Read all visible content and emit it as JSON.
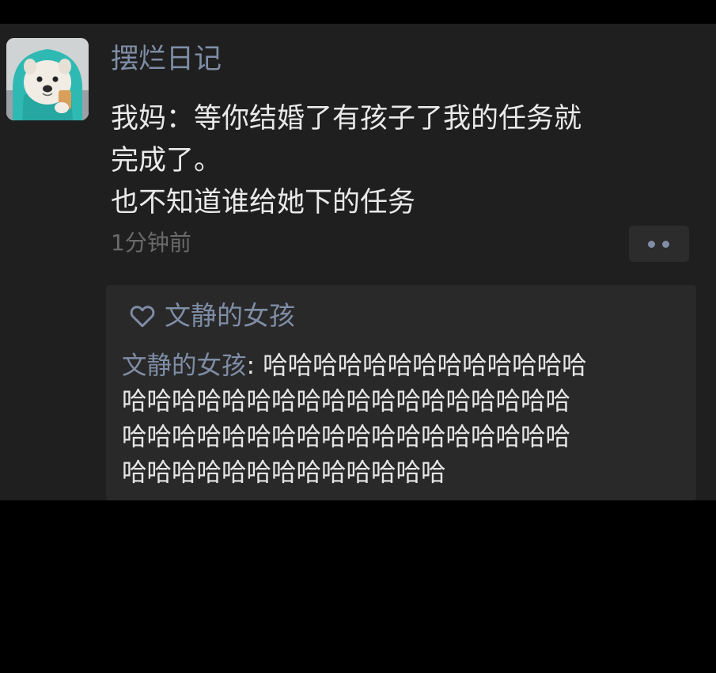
{
  "post": {
    "author": "摆烂日记",
    "lines": [
      "我妈：等你结婚了有孩子了我的任务就",
      "完成了。",
      "也不知道谁给她下的任务"
    ],
    "timestamp": "1分钟前",
    "more_icon": "more-dots-icon"
  },
  "interactions": {
    "like_icon": "heart-outline-icon",
    "liker": "文静的女孩",
    "comment": {
      "author": "文静的女孩",
      "separator": ": ",
      "lines": [
        "哈哈哈哈哈哈哈哈哈哈哈哈哈",
        "哈哈哈哈哈哈哈哈哈哈哈哈哈哈哈哈哈哈",
        "哈哈哈哈哈哈哈哈哈哈哈哈哈哈哈哈哈哈",
        "哈哈哈哈哈哈哈哈哈哈哈哈哈"
      ]
    }
  },
  "colors": {
    "background": "#000000",
    "card": "#1f1f1f",
    "comment_panel": "#292929",
    "name_accent": "#7f8da6",
    "body_text": "#e9e9e9",
    "timestamp": "#6a6a6a"
  }
}
